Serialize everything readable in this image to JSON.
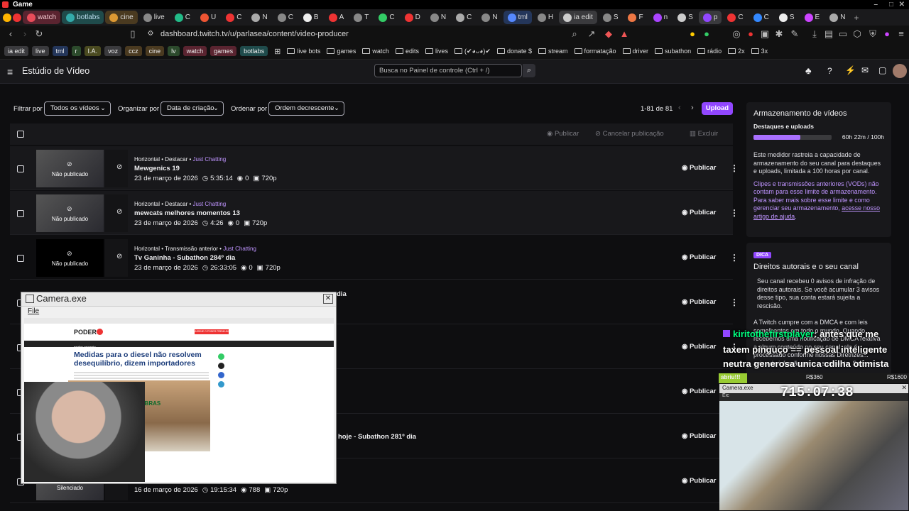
{
  "window_title": "Game",
  "tabs": [
    {
      "label": "watch",
      "style": "grp",
      "color": "#e84c5a"
    },
    {
      "label": "botlabs",
      "style": "teal",
      "color": "#3aa"
    },
    {
      "label": "cine",
      "style": "olive",
      "color": "#d93"
    },
    {
      "label": "live",
      "style": "",
      "color": "#888"
    },
    {
      "label": "C",
      "style": "",
      "color": "#2b8"
    },
    {
      "label": "U",
      "style": "",
      "color": "#e53"
    },
    {
      "label": "C",
      "style": "",
      "color": "#e33"
    },
    {
      "label": "N",
      "style": "",
      "color": "#aaa"
    },
    {
      "label": "C",
      "style": "",
      "color": "#888"
    },
    {
      "label": "B",
      "style": "",
      "color": "#eee"
    },
    {
      "label": "A",
      "style": "",
      "color": "#e33"
    },
    {
      "label": "T",
      "style": "",
      "color": "#888"
    },
    {
      "label": "C",
      "style": "",
      "color": "#3c6"
    },
    {
      "label": "D",
      "style": "",
      "color": "#e33"
    },
    {
      "label": "N",
      "style": "",
      "color": "#888"
    },
    {
      "label": "C",
      "style": "",
      "color": "#aaa"
    },
    {
      "label": "N",
      "style": "",
      "color": "#888"
    },
    {
      "label": "tml",
      "style": "blue",
      "color": "#58f"
    },
    {
      "label": "H",
      "style": "",
      "color": "#888"
    },
    {
      "label": "ia edit",
      "style": "active",
      "color": "#ccc"
    },
    {
      "label": "S",
      "style": "",
      "color": "#888"
    },
    {
      "label": "F",
      "style": "",
      "color": "#e74"
    },
    {
      "label": "n",
      "style": "",
      "color": "#a4f"
    },
    {
      "label": "S",
      "style": "",
      "color": "#ccc"
    },
    {
      "label": "p",
      "style": "active",
      "color": "#9147ff"
    },
    {
      "label": "C",
      "style": "",
      "color": "#e33"
    },
    {
      "label": "C",
      "style": "",
      "color": "#38f"
    },
    {
      "label": "S",
      "style": "",
      "color": "#eee"
    },
    {
      "label": "E",
      "style": "",
      "color": "#c4f"
    },
    {
      "label": "N",
      "style": "",
      "color": "#aaa"
    }
  ],
  "address": "dashboard.twitch.tv/u/parlasea/content/video-producer",
  "bookmarks": {
    "chips": [
      {
        "label": "ia edit",
        "color": "#3a3a3d"
      },
      {
        "label": "live",
        "color": "#3a3a3d"
      },
      {
        "label": "tml",
        "color": "#24365a"
      },
      {
        "label": "r",
        "color": "#2c4a2c"
      },
      {
        "label": "I.A.",
        "color": "#4a4a20"
      },
      {
        "label": "voz",
        "color": "#3a3a3d"
      },
      {
        "label": "ccz",
        "color": "#4a3a20"
      },
      {
        "label": "cine",
        "color": "#4a3a20"
      },
      {
        "label": "lv",
        "color": "#2c4a2c"
      },
      {
        "label": "watch",
        "color": "#5a2430"
      },
      {
        "label": "games",
        "color": "#5a2430"
      },
      {
        "label": "botlabs",
        "color": "#1f4b4b"
      }
    ],
    "items": [
      "live bots",
      "games",
      "watch",
      "edits",
      "lives",
      "(✔︎◕ᴗ◕)✔︎",
      "donate $",
      "stream",
      "formatação",
      "driver",
      "subathon",
      "rádio",
      "2x",
      "3x"
    ]
  },
  "app": {
    "title": "Estúdio de Vídeo",
    "search_placeholder": "Busca no Painel de controle (Ctrl + /)"
  },
  "filters": {
    "filter_label": "Filtrar por",
    "filter_value": "Todos os vídeos",
    "organize_label": "Organizar por",
    "organize_value": "Data de criação",
    "order_label": "Ordenar por",
    "order_value": "Ordem decrescente",
    "count": "1-81 de 81",
    "upload": "Upload"
  },
  "bulk_actions": {
    "publish": "Publicar",
    "unpublish": "Cancelar publicação",
    "delete": "Excluir"
  },
  "publish_label": "Publicar",
  "videos": [
    {
      "thumb_label": "Não publicado",
      "meta": "Horizontal • Destacar • ",
      "category": "Just Chatting",
      "title": "Mewgenics 19",
      "date": "23 de março de 2026",
      "duration": "5:35:14",
      "views": "0",
      "quality": "720p"
    },
    {
      "thumb_label": "Não publicado",
      "meta": "Horizontal • Destacar • ",
      "category": "Just Chatting",
      "title": "mewcats melhores momentos 13",
      "date": "23 de março de 2026",
      "duration": "4:26",
      "views": "0",
      "quality": "720p"
    },
    {
      "thumb_label": "Não publicado",
      "meta": "Horizontal • Transmissão anterior • ",
      "category": "Just Chatting",
      "title": "Tv Ganinha - Subathon 284º dia",
      "date": "23 de março de 2026",
      "duration": "26:33:05",
      "views": "0",
      "quality": "720p"
    },
    {
      "title_tail": "dia"
    },
    {},
    {},
    {
      "title_tail": "hoje - Subathon 281º dia"
    },
    {
      "thumb_label": "Silenciado",
      "date": "16 de março de 2026",
      "duration": "19:15:34",
      "views": "788",
      "quality": "720p"
    }
  ],
  "storage": {
    "title": "Armazenamento de vídeos",
    "subtitle": "Destaques e uploads",
    "usage": "60h 22m / 100h",
    "usage_fraction": 0.6037,
    "p1": "Este medidor rastreia a capacidade de armazenamento do seu canal para destaques e uploads, limitada a 100 horas por canal.",
    "p2": "Clipes e transmissões anteriores (VODs) não contam para esse limite de armazenamento. Para saber mais sobre esse limite e como gerenciar seu armazenamento, ",
    "p2_link": "acesse nosso artigo de ajuda",
    "p2_end": "."
  },
  "tip": {
    "badge": "DICA",
    "title": "Direitos autorais e o seu canal",
    "p1": "Seu canal recebeu 0 avisos de infração de direitos autorais. Se você acumular 3 avisos desse tipo, sua conta estará sujeita a rescisão.",
    "p2": "A Twitch cumpre com a DMCA e com leis semelhantes em todo o mundo. Quando recebemos uma notificação de DMCA relativa a algum conteúdo no seu canal, ele é processado conforme nossas Diretrizes... aviso de infração para a sua conta. Se isso"
  },
  "popup_window": {
    "title": "Camera.exe",
    "menu": "File",
    "article_logo": "PODER",
    "article_section": "poder energia",
    "article_headline": "Medidas para o diesel não resolvem desequilíbrio, dizem importadores",
    "article_brand": "PETROBRAS",
    "article_btn": "ASSINE O PODER PREMIUM"
  },
  "overlay": {
    "chat_user": "kiritothefirstplayer",
    "chat_line1": ": antes que me",
    "chat_line2": "taxem pinguço == pessoal inteligente",
    "chat_line3": "neutra generosa unica cdilha otimista",
    "goal_left": "abriu!!!",
    "goal_mid": "R$360",
    "goal_right": "R$1600",
    "cam_title": "Camera.exe",
    "cam_menu": "Eic",
    "timer": "715:07:38"
  },
  "colors": {
    "accent": "#9147ff",
    "link": "#bf94ff"
  }
}
